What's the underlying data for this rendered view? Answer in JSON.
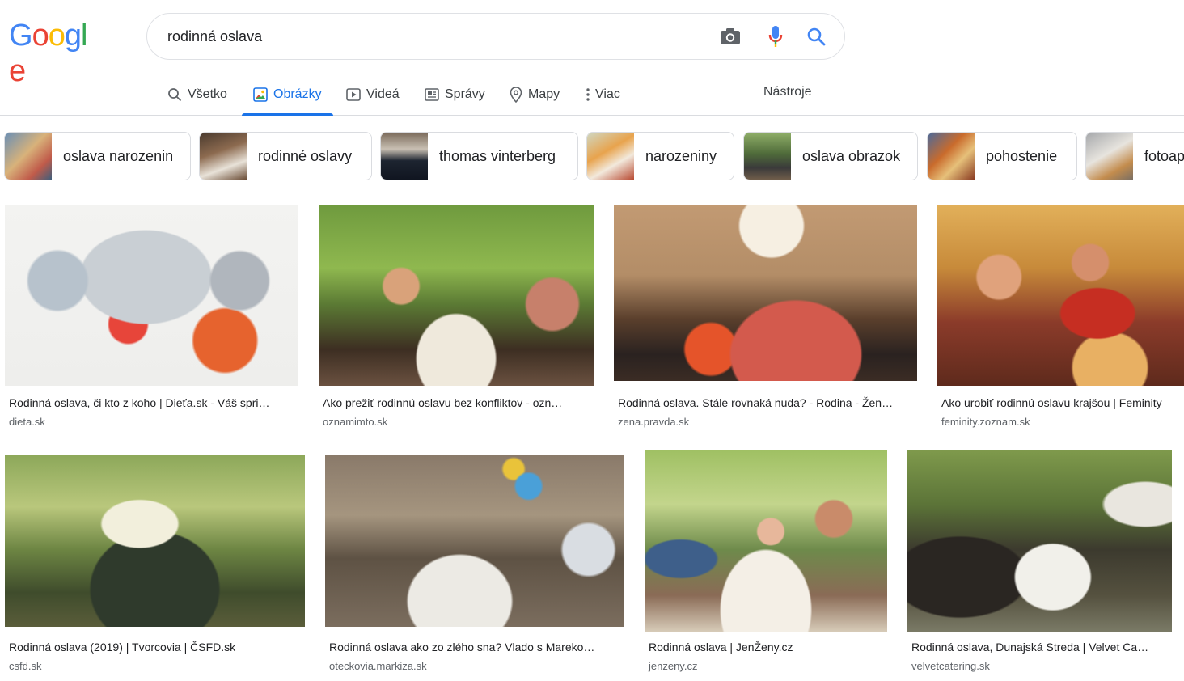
{
  "logo": {
    "letters": [
      "G",
      "o",
      "o",
      "g",
      "l",
      "e"
    ],
    "colors": [
      "#4285f4",
      "#ea4335",
      "#fbbc05",
      "#4285f4",
      "#34a853",
      "#ea4335"
    ]
  },
  "search": {
    "query": "rodinná oslava",
    "icons": [
      "camera-icon",
      "microphone-icon",
      "search-icon"
    ]
  },
  "tabs": [
    {
      "label": "Všetko",
      "icon": "search-icon"
    },
    {
      "label": "Obrázky",
      "icon": "image-icon",
      "active": true
    },
    {
      "label": "Videá",
      "icon": "play-icon"
    },
    {
      "label": "Správy",
      "icon": "news-icon"
    },
    {
      "label": "Mapy",
      "icon": "pin-icon"
    },
    {
      "label": "Viac",
      "icon": "more-vert-icon"
    }
  ],
  "tools_label": "Nástroje",
  "chips": [
    {
      "label": "oslava narozenin"
    },
    {
      "label": "rodinné oslavy"
    },
    {
      "label": "thomas vinterberg"
    },
    {
      "label": "narozeniny"
    },
    {
      "label": "oslava obrazok"
    },
    {
      "label": "pohostenie"
    },
    {
      "label": "fotoap"
    }
  ],
  "results": [
    {
      "title": "Rodinná oslava, či kto z koho | Dieťa.sk - Váš spri…",
      "source": "dieta.sk"
    },
    {
      "title": "Ako prežiť rodinnú oslavu bez konfliktov - ozn…",
      "source": "oznamimto.sk"
    },
    {
      "title": "Rodinná oslava. Stále rovnaká nuda? - Rodina - Žen…",
      "source": "zena.pravda.sk"
    },
    {
      "title": "Ako urobiť rodinnú oslavu krajšou | Feminity",
      "source": "feminity.zoznam.sk"
    },
    {
      "title": "Rodinná oslava (2019) | Tvorcovia | ČSFD.sk",
      "source": "csfd.sk"
    },
    {
      "title": "Rodinná oslava ako zo zlého sna? Vlado s Mareko…",
      "source": "oteckovia.markiza.sk"
    },
    {
      "title": "Rodinná oslava | JenŽeny.cz",
      "source": "jenzeny.cz"
    },
    {
      "title": "Rodinná oslava, Dunajská Streda | Velvet Ca…",
      "source": "velvetcatering.sk"
    }
  ],
  "colors": {
    "accent": "#1a73e8",
    "text": "#202124",
    "muted": "#5f6368",
    "border": "#dadce0"
  }
}
